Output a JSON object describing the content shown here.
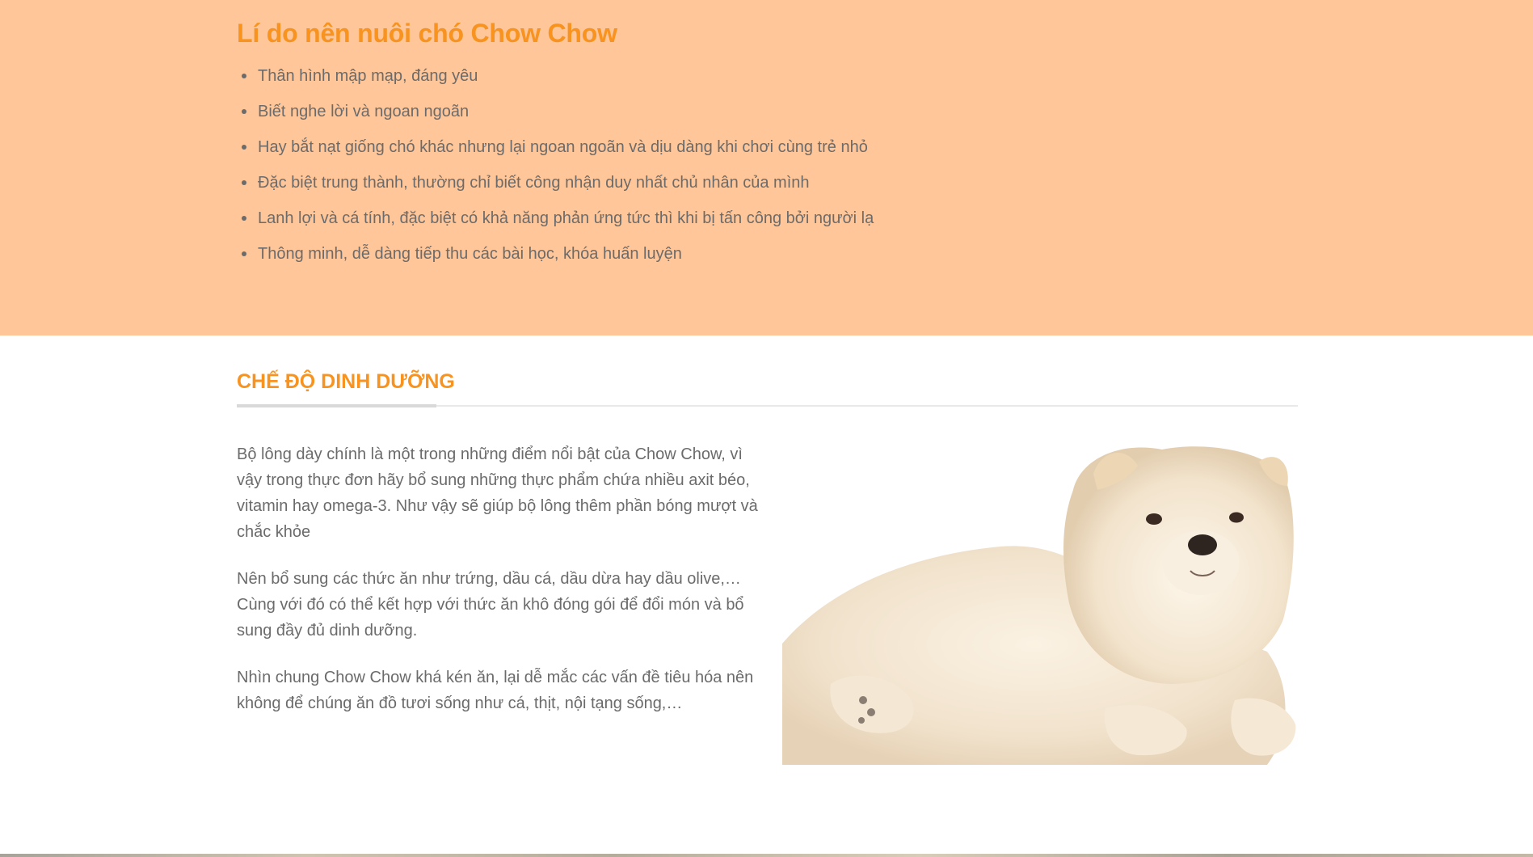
{
  "reasons": {
    "title": "Lí do nên nuôi chó Chow Chow",
    "items": [
      "Thân hình mập mạp, đáng yêu",
      "Biết nghe lời và ngoan ngoãn",
      "Hay bắt nạt giống chó khác nhưng lại ngoan ngoãn và dịu dàng khi chơi cùng trẻ nhỏ",
      "Đặc biệt trung thành, thường chỉ biết công nhận duy nhất chủ nhân của mình",
      "Lanh lợi và cá tính, đặc biệt có khả năng phản ứng tức thì khi bị tấn công bởi người lạ",
      "Thông minh, dễ dàng tiếp thu các bài học, khóa huấn luyện"
    ]
  },
  "nutrition": {
    "heading": "CHẾ ĐỘ DINH DƯỠNG",
    "paragraphs": [
      "Bộ lông dày chính là một trong những điểm nổi bật của Chow Chow, vì vậy trong thực đơn hãy bổ sung những thực phẩm chứa nhiều axit béo, vitamin hay omega-3. Như vậy sẽ giúp bộ lông thêm phần bóng mượt và chắc khỏe",
      "Nên bổ sung các thức ăn như trứng, dầu cá, dầu dừa hay dầu olive,… Cùng với đó có thể kết hợp với thức ăn khô đóng gói để đổi món và bổ sung đầy đủ dinh dưỡng.",
      "Nhìn chung Chow Chow khá kén ăn, lại dễ mắc các vấn đề tiêu hóa nên không để chúng ăn đồ tươi sống như cá, thịt, nội tạng sống,…"
    ],
    "image_icon": "chow-chow-puppy-photo"
  },
  "colors": {
    "section_background": "#fec699",
    "accent": "#f7931e",
    "body_text": "#6b6b6b"
  }
}
